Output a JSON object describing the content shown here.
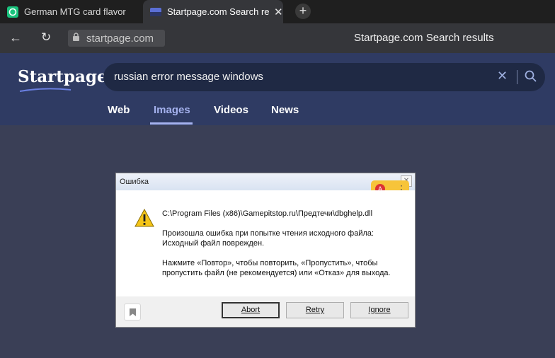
{
  "browser": {
    "tabs": [
      {
        "title": "German MTG card flavor te",
        "active": false,
        "favicon": "chatgpt-icon"
      },
      {
        "title": "Startpage.com Search re",
        "active": true,
        "favicon": "startpage-icon"
      }
    ],
    "new_tab_label": "+",
    "close_glyph": "✕",
    "url": "startpage.com",
    "page_title": "Startpage.com Search results"
  },
  "startpage": {
    "logo": "Startpage",
    "query": "russian error message windows",
    "nav": [
      "Web",
      "Images",
      "Videos",
      "News"
    ],
    "active_nav": "Images"
  },
  "dialog": {
    "title": "Ошибка",
    "path": "C:\\Program Files (x86)\\Gamepitstop.ru\\Предтечи\\dbghelp.dll",
    "line1": "Произошла ошибка при попытке чтения исходного файла:",
    "line2": "Исходный файл поврежден.",
    "line3": "Нажмите «Повтор», чтобы повторить, «Пропустить», чтобы",
    "line4": "пропустить файл (не рекомендуется) или «Отказ» для выхода.",
    "buttons": {
      "abort": "Abort",
      "retry": "Retry",
      "ignore": "Ignore"
    }
  },
  "colors": {
    "header_bg": "#2f3b63",
    "content_bg": "#3a3f56",
    "accent": "#a5b2ee"
  }
}
